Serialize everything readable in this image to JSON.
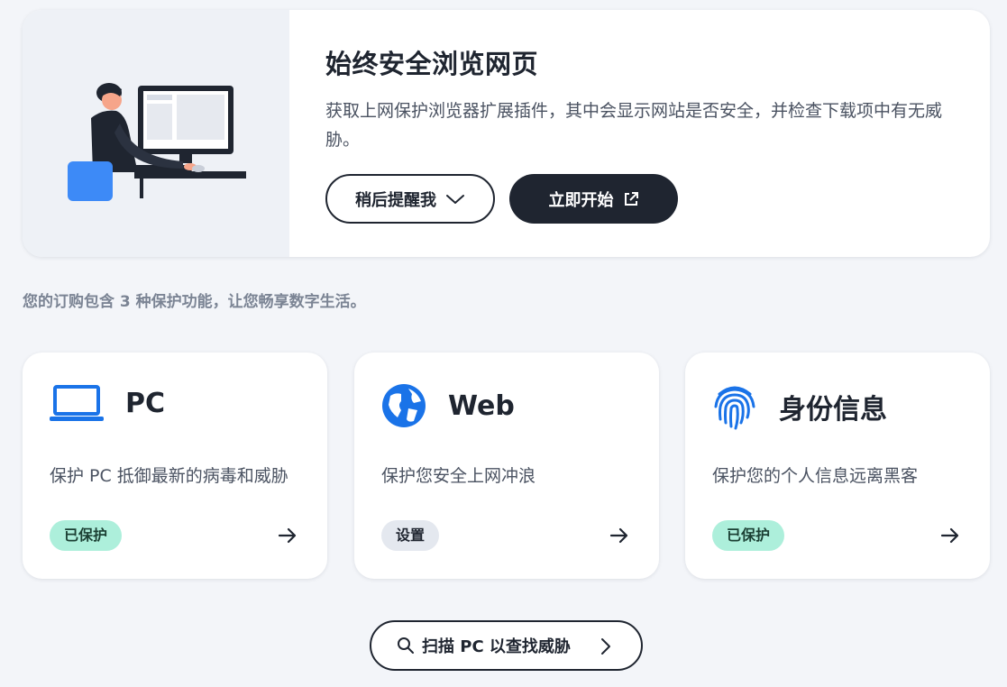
{
  "promo": {
    "title": "始终安全浏览网页",
    "description": "获取上网保护浏览器扩展插件，其中会显示网站是否安全，并检查下载项中有无威胁。",
    "remind_label": "稍后提醒我",
    "start_label": "立即开始"
  },
  "summary": "您的订购包含 3 种保护功能，让您畅享数字生活。",
  "cards": [
    {
      "title": "PC",
      "description": "保护 PC 抵御最新的病毒和威胁",
      "status": "已保护",
      "icon": "laptop-icon"
    },
    {
      "title": "Web",
      "description": "保护您安全上网冲浪",
      "status": "设置",
      "icon": "globe-icon"
    },
    {
      "title": "身份信息",
      "description": "保护您的个人信息远离黑客",
      "status": "已保护",
      "icon": "fingerprint-icon"
    }
  ],
  "scan": {
    "label": "扫描 PC 以查找威胁"
  },
  "colors": {
    "accent_blue": "#1a73e8",
    "dark": "#1f2530",
    "protected_badge": "#adefdb",
    "background": "#f3f5f9"
  }
}
